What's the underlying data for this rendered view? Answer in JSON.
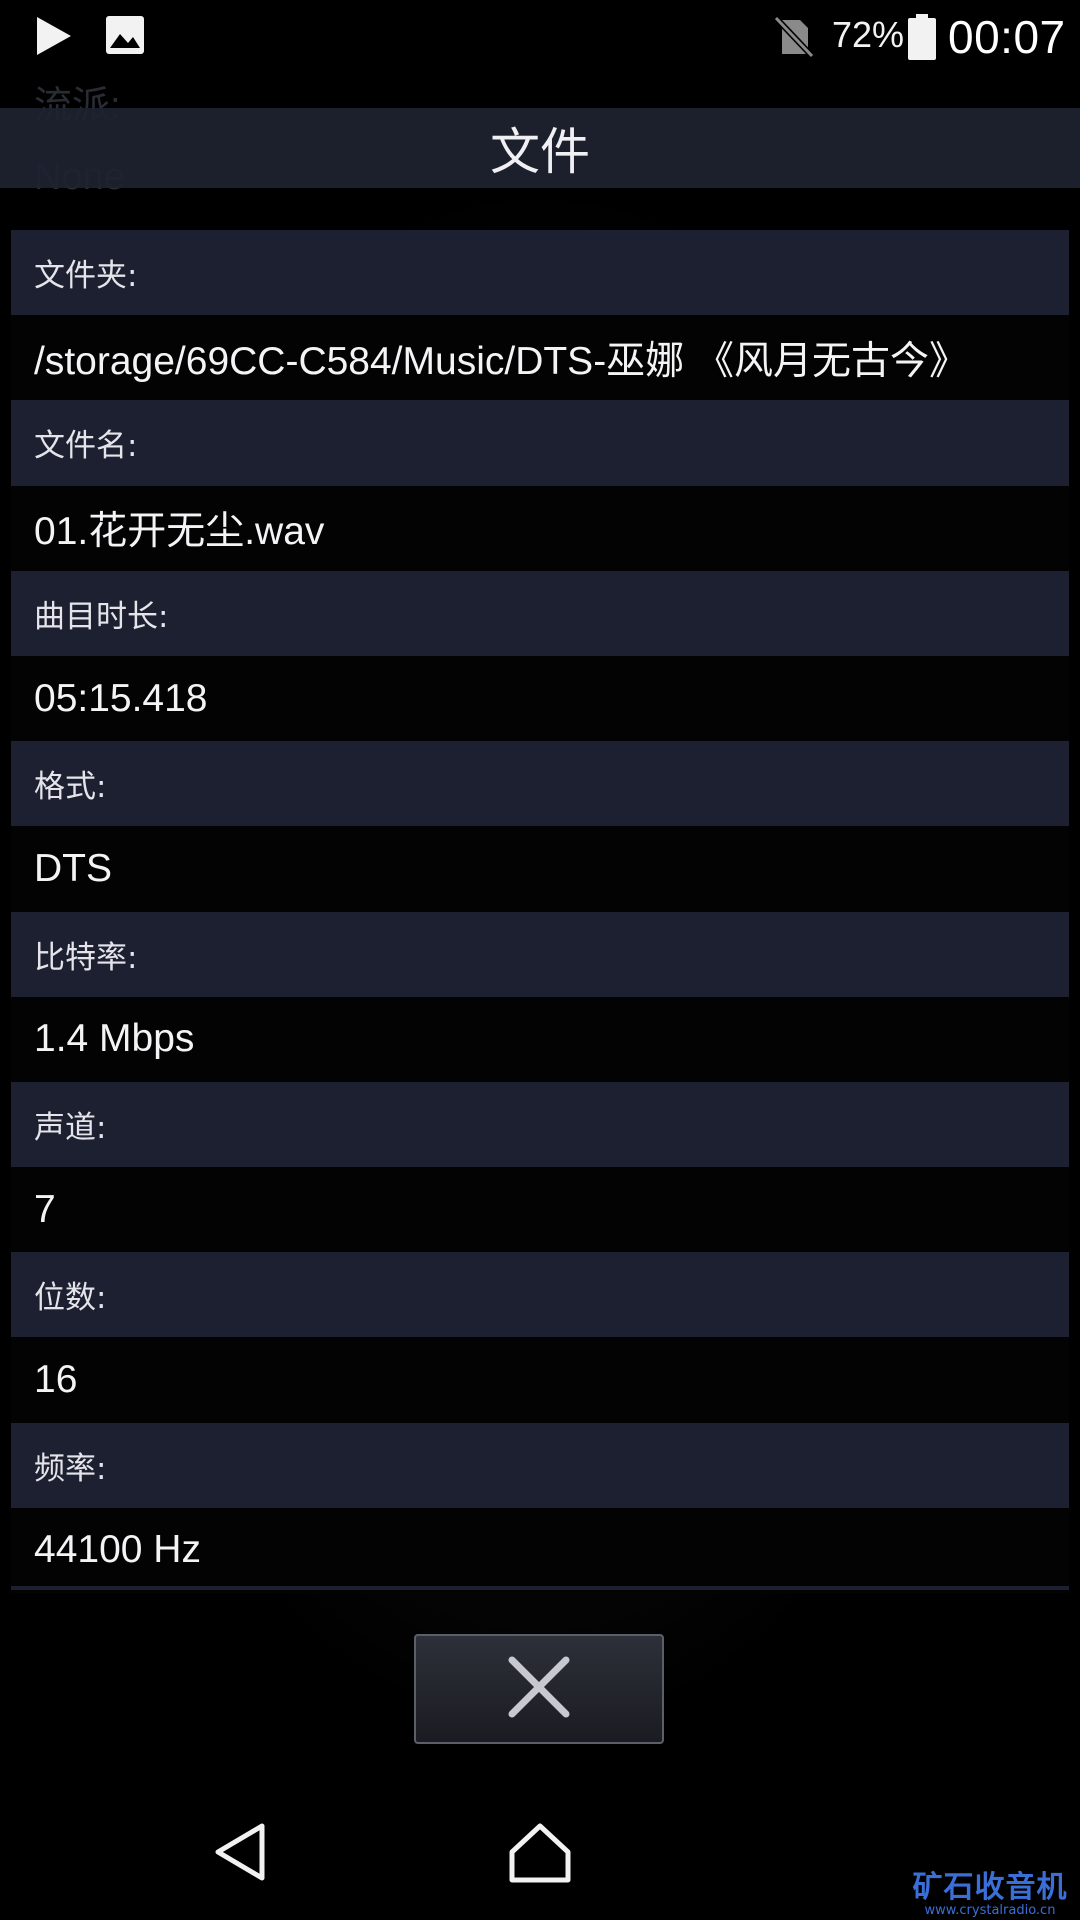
{
  "status_bar": {
    "battery_percent": "72%",
    "time": "00:07",
    "icons": [
      "play-icon",
      "image-icon",
      "no-sim-icon",
      "battery-icon"
    ]
  },
  "background_text": {
    "genre_label": "流派:",
    "genre_value": "None"
  },
  "dialog": {
    "title": "文件",
    "fields": [
      {
        "label": "文件夹:",
        "value": "/storage/69CC-C584/Music/DTS-巫娜 《风月无古今》"
      },
      {
        "label": "文件名:",
        "value": "01.花开无尘.wav"
      },
      {
        "label": "曲目时长:",
        "value": "05:15.418"
      },
      {
        "label": "格式:",
        "value": "DTS"
      },
      {
        "label": "比特率:",
        "value": "1.4 Mbps"
      },
      {
        "label": "声道:",
        "value": "7"
      },
      {
        "label": "位数:",
        "value": "16"
      },
      {
        "label": "频率:",
        "value": "44100 Hz"
      }
    ],
    "close_icon": "close-icon"
  },
  "nav_bar": {
    "icons": [
      "back-icon",
      "home-icon"
    ]
  },
  "watermark": {
    "title": "矿石收音机",
    "url": "www.crystalradio.cn"
  },
  "colors": {
    "background": "#000000",
    "header_bg": "#1e2230",
    "label_row_bg": "#1c2030",
    "value_row_bg": "#030304",
    "text": "#f0f0f4",
    "watermark": "#3a6fd8"
  }
}
